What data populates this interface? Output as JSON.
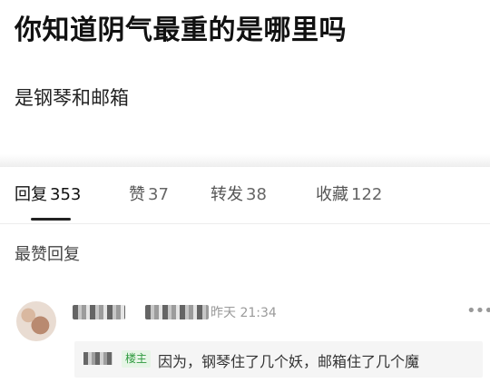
{
  "post": {
    "title": "你知道阴气最重的是哪里吗",
    "body": "是钢琴和邮箱"
  },
  "tabs": [
    {
      "label": "回复",
      "count": "353",
      "active": true
    },
    {
      "label": "赞",
      "count": "37",
      "active": false
    },
    {
      "label": "转发",
      "count": "38",
      "active": false
    },
    {
      "label": "收藏",
      "count": "122",
      "active": false
    }
  ],
  "section": {
    "title": "最赞回复"
  },
  "comment": {
    "timestamp": "昨天 21:34",
    "more_icon": "more-horizontal-icon",
    "reply": {
      "badge": "楼主",
      "text": "因为，钢琴住了几个妖，邮箱住了几个魔"
    }
  },
  "colors": {
    "badge_bg": "#e6f5e6",
    "badge_text": "#2f9a3f",
    "tab_indicator": "#222222"
  }
}
